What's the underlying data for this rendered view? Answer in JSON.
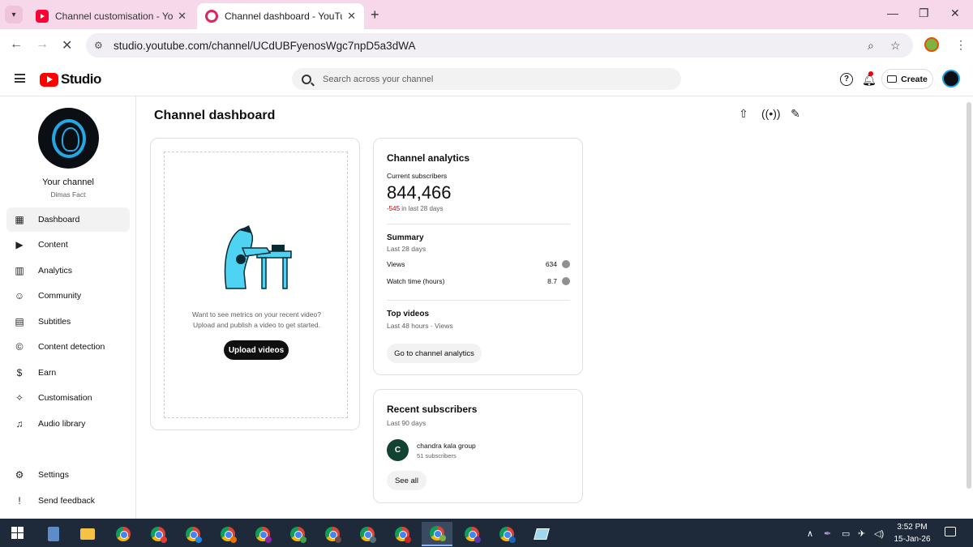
{
  "browser": {
    "tabs": [
      {
        "title": "Channel customisation - YouTu",
        "active": false
      },
      {
        "title": "Channel dashboard - YouTube",
        "active": true
      }
    ],
    "url": "studio.youtube.com/channel/UCdUBFyenosWgc7npD5a3dWA"
  },
  "header": {
    "logo_text": "Studio",
    "search_placeholder": "Search across your channel",
    "create_label": "Create"
  },
  "sidebar": {
    "channel_title": "Your channel",
    "channel_name": "Dimas Fact",
    "items": [
      {
        "label": "Dashboard",
        "icon": "dashboard-icon",
        "active": true
      },
      {
        "label": "Content",
        "icon": "content-icon"
      },
      {
        "label": "Analytics",
        "icon": "analytics-icon"
      },
      {
        "label": "Community",
        "icon": "community-icon"
      },
      {
        "label": "Subtitles",
        "icon": "subtitles-icon"
      },
      {
        "label": "Content detection",
        "icon": "copyright-icon"
      },
      {
        "label": "Earn",
        "icon": "dollar-icon"
      },
      {
        "label": "Customisation",
        "icon": "magic-wand-icon"
      },
      {
        "label": "Audio library",
        "icon": "audio-library-icon"
      }
    ],
    "bottom_items": [
      {
        "label": "Settings",
        "icon": "gear-icon"
      },
      {
        "label": "Send feedback",
        "icon": "feedback-icon"
      }
    ]
  },
  "main": {
    "page_title": "Channel dashboard",
    "upload_card": {
      "message_line1": "Want to see metrics on your recent video?",
      "message_line2": "Upload and publish a video to get started.",
      "button_label": "Upload videos"
    },
    "analytics_card": {
      "title": "Channel analytics",
      "current_subscribers_label": "Current subscribers",
      "current_subscribers": "844,466",
      "subscriber_change": "-545",
      "subscriber_change_period": " in last 28 days",
      "summary_title": "Summary",
      "summary_period": "Last 28 days",
      "metrics": [
        {
          "label": "Views",
          "value": "634"
        },
        {
          "label": "Watch time (hours)",
          "value": "8.7"
        }
      ],
      "top_videos_title": "Top videos",
      "top_videos_period": "Last 48 hours · Views",
      "button_label": "Go to channel analytics"
    },
    "subscribers_card": {
      "title": "Recent subscribers",
      "period": "Last 90 days",
      "subscribers": [
        {
          "initial": "C",
          "name": "chandra kala group",
          "count": "51 subscribers"
        }
      ],
      "button_label": "See all"
    }
  },
  "taskbar": {
    "time": "3:52 PM",
    "date": "15-Jan-26"
  },
  "colors": {
    "tabstrip": "#f7d8ea",
    "brand_red": "#ff0000",
    "negative": "#cc0000",
    "taskbar": "#1e2a3a"
  }
}
